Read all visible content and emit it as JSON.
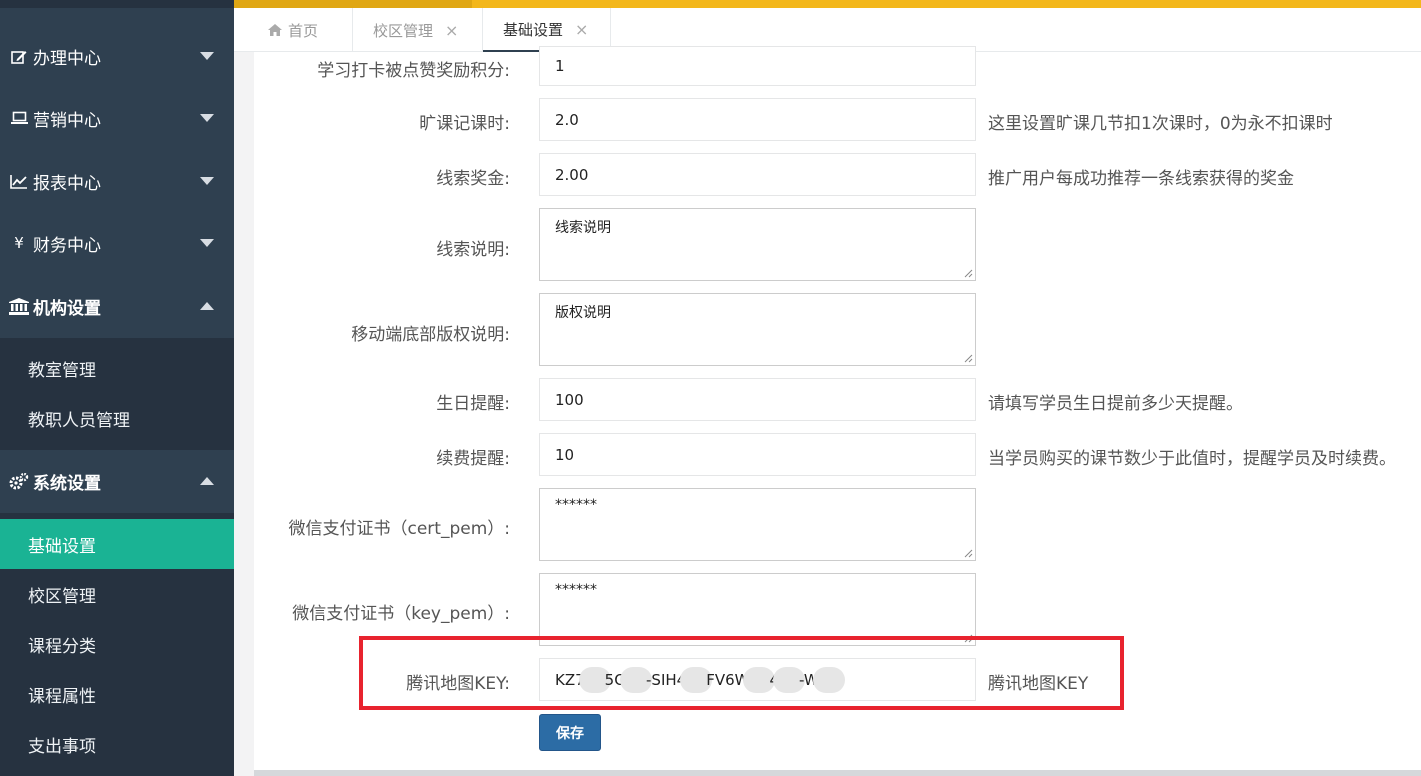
{
  "sidebar": {
    "menus": [
      {
        "label": "办理中心",
        "icon": "edit-icon",
        "expanded": false
      },
      {
        "label": "营销中心",
        "icon": "laptop-icon",
        "expanded": false
      },
      {
        "label": "报表中心",
        "icon": "line-chart-icon",
        "expanded": false
      },
      {
        "label": "财务中心",
        "icon": "yen-icon",
        "expanded": false
      },
      {
        "label": "机构设置",
        "icon": "bank-icon",
        "expanded": true
      },
      {
        "label": "系统设置",
        "icon": "cogs-icon",
        "expanded": true
      }
    ],
    "org_items": [
      "教室管理",
      "教职人员管理"
    ],
    "sys_items": [
      "基础设置",
      "校区管理",
      "课程分类",
      "课程属性",
      "支出事项"
    ],
    "icons": {
      "yen": "¥"
    },
    "active_color": "#1ab394"
  },
  "tabs": [
    {
      "label": "首页",
      "closable": false,
      "active": false
    },
    {
      "label": "校区管理",
      "closable": true,
      "active": false
    },
    {
      "label": "基础设置",
      "closable": true,
      "active": true
    }
  ],
  "tab_close_glyph": "×",
  "form": {
    "study_reward": {
      "label": "学习打卡被点赞奖励积分:",
      "value": "1"
    },
    "absence": {
      "label": "旷课记课时:",
      "value": "2.0",
      "help": "这里设置旷课几节扣1次课时，0为永不扣课时"
    },
    "lead_bonus": {
      "label": "线索奖金:",
      "value": "2.00",
      "help": "推广用户每成功推荐一条线索获得的奖金"
    },
    "lead_desc": {
      "label": "线索说明:",
      "value": "线索说明"
    },
    "copyright": {
      "label": "移动端底部版权说明:",
      "value": "版权说明"
    },
    "birthday": {
      "label": "生日提醒:",
      "value": "100",
      "help": "请填写学员生日提前多少天提醒。"
    },
    "renewal": {
      "label": "续费提醒:",
      "value": "10",
      "help": "当学员购买的课节数少于此值时，提醒学员及时续费。"
    },
    "cert_pem": {
      "label": "微信支付证书（cert_pem）:",
      "value": "******"
    },
    "key_pem": {
      "label": "微信支付证书（key_pem）:",
      "value": "******"
    },
    "map_key": {
      "label": "腾讯地图KEY:",
      "value_parts": [
        "KZ7",
        "5O",
        "-SIH4",
        "FV6W",
        "4",
        "-W"
      ],
      "help": "腾讯地图KEY"
    },
    "save_label": "保存"
  },
  "colors": {
    "topbar": "#f3b71b",
    "sidebar": "#2f4050",
    "highlight": "#e8232e",
    "save_button": "#2c6ca5"
  }
}
